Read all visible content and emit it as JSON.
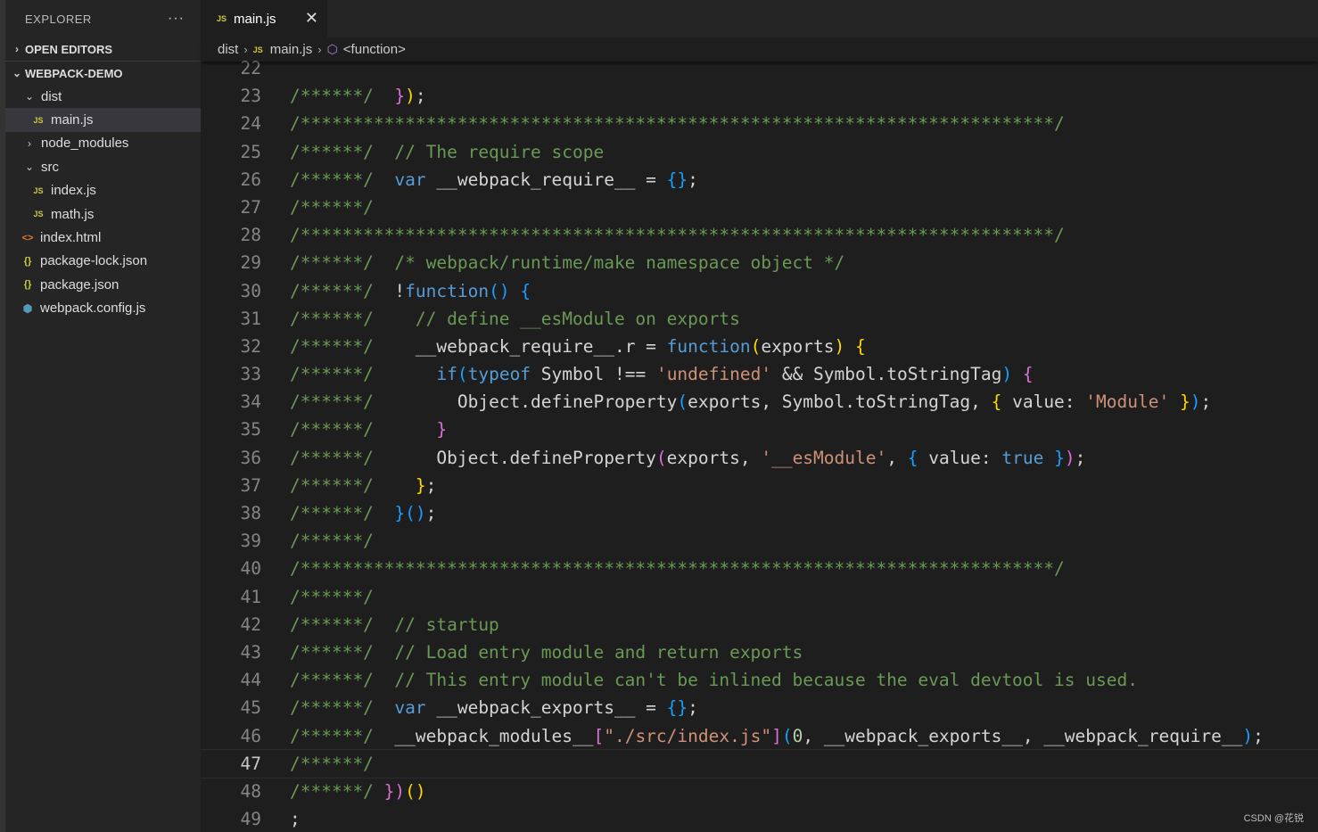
{
  "sidebar": {
    "title": "EXPLORER",
    "more_icon": "ellipsis-icon",
    "open_editors": "OPEN EDITORS",
    "project": "WEBPACK-DEMO",
    "tree": [
      {
        "label": "dist",
        "type": "folder",
        "expanded": true,
        "depth": 1
      },
      {
        "label": "main.js",
        "type": "js",
        "depth": 2,
        "selected": true
      },
      {
        "label": "node_modules",
        "type": "folder",
        "expanded": false,
        "depth": 1
      },
      {
        "label": "src",
        "type": "folder",
        "expanded": true,
        "depth": 1
      },
      {
        "label": "index.js",
        "type": "js",
        "depth": 2
      },
      {
        "label": "math.js",
        "type": "js",
        "depth": 2
      },
      {
        "label": "index.html",
        "type": "html",
        "depth": 1
      },
      {
        "label": "package-lock.json",
        "type": "json",
        "depth": 1
      },
      {
        "label": "package.json",
        "type": "json",
        "depth": 1
      },
      {
        "label": "webpack.config.js",
        "type": "cfg",
        "depth": 1
      }
    ]
  },
  "tab": {
    "label": "main.js",
    "icon": "JS",
    "close": "✕"
  },
  "breadcrumb": {
    "folder": "dist",
    "file": "main.js",
    "symbol": "<function>"
  },
  "icons": {
    "js": "JS",
    "html": "<>",
    "json": "{}",
    "cfg": "⬢",
    "folder_open": "⌄",
    "folder_closed": "›"
  },
  "editor": {
    "current_line": 47,
    "lines": [
      {
        "n": 22,
        "t": [
          [
            "pl",
            ""
          ]
        ]
      },
      {
        "n": 23,
        "t": [
          [
            "cm",
            "/******/  "
          ],
          [
            "br2",
            "}"
          ],
          [
            "br1",
            ")"
          ],
          [
            "pl",
            ";"
          ]
        ]
      },
      {
        "n": 24,
        "t": [
          [
            "cm",
            "/************************************************************************/"
          ]
        ]
      },
      {
        "n": 25,
        "t": [
          [
            "cm",
            "/******/  // The require scope"
          ]
        ]
      },
      {
        "n": 26,
        "t": [
          [
            "cm",
            "/******/  "
          ],
          [
            "kw",
            "var"
          ],
          [
            "pl",
            " __webpack_require__ = "
          ],
          [
            "br3",
            "{}"
          ],
          [
            "pl",
            ";"
          ]
        ]
      },
      {
        "n": 27,
        "t": [
          [
            "cm",
            "/******/"
          ]
        ]
      },
      {
        "n": 28,
        "t": [
          [
            "cm",
            "/************************************************************************/"
          ]
        ]
      },
      {
        "n": 29,
        "t": [
          [
            "cm",
            "/******/  /* webpack/runtime/make namespace object */"
          ]
        ]
      },
      {
        "n": 30,
        "t": [
          [
            "cm",
            "/******/  "
          ],
          [
            "pl",
            "!"
          ],
          [
            "kw",
            "function"
          ],
          [
            "br3",
            "()"
          ],
          [
            "pl",
            " "
          ],
          [
            "br3",
            "{"
          ]
        ]
      },
      {
        "n": 31,
        "t": [
          [
            "cm",
            "/******/    // define __esModule on exports"
          ]
        ]
      },
      {
        "n": 32,
        "t": [
          [
            "cm",
            "/******/    "
          ],
          [
            "pl",
            "__webpack_require__.r = "
          ],
          [
            "kw",
            "function"
          ],
          [
            "br1",
            "("
          ],
          [
            "pl",
            "exports"
          ],
          [
            "br1",
            ")"
          ],
          [
            "pl",
            " "
          ],
          [
            "br1",
            "{"
          ]
        ]
      },
      {
        "n": 33,
        "t": [
          [
            "cm",
            "/******/      "
          ],
          [
            "kw",
            "if"
          ],
          [
            "br3",
            "("
          ],
          [
            "kw",
            "typeof"
          ],
          [
            "pl",
            " Symbol !== "
          ],
          [
            "str",
            "'undefined'"
          ],
          [
            "pl",
            " && Symbol.toStringTag"
          ],
          [
            "br3",
            ")"
          ],
          [
            "pl",
            " "
          ],
          [
            "br2",
            "{"
          ]
        ]
      },
      {
        "n": 34,
        "t": [
          [
            "cm",
            "/******/        "
          ],
          [
            "pl",
            "Object.defineProperty"
          ],
          [
            "br3",
            "("
          ],
          [
            "pl",
            "exports, Symbol.toStringTag, "
          ],
          [
            "br1",
            "{"
          ],
          [
            "pl",
            " value: "
          ],
          [
            "str",
            "'Module'"
          ],
          [
            "pl",
            " "
          ],
          [
            "br1",
            "}"
          ],
          [
            "br3",
            ")"
          ],
          [
            "pl",
            ";"
          ]
        ]
      },
      {
        "n": 35,
        "t": [
          [
            "cm",
            "/******/      "
          ],
          [
            "br2",
            "}"
          ]
        ]
      },
      {
        "n": 36,
        "t": [
          [
            "cm",
            "/******/      "
          ],
          [
            "pl",
            "Object.defineProperty"
          ],
          [
            "br2",
            "("
          ],
          [
            "pl",
            "exports, "
          ],
          [
            "str",
            "'__esModule'"
          ],
          [
            "pl",
            ", "
          ],
          [
            "br3",
            "{"
          ],
          [
            "pl",
            " value: "
          ],
          [
            "kw",
            "true"
          ],
          [
            "pl",
            " "
          ],
          [
            "br3",
            "}"
          ],
          [
            "br2",
            ")"
          ],
          [
            "pl",
            ";"
          ]
        ]
      },
      {
        "n": 37,
        "t": [
          [
            "cm",
            "/******/    "
          ],
          [
            "br1",
            "}"
          ],
          [
            "pl",
            ";"
          ]
        ]
      },
      {
        "n": 38,
        "t": [
          [
            "cm",
            "/******/  "
          ],
          [
            "br3",
            "}"
          ],
          [
            "br3",
            "()"
          ],
          [
            "pl",
            ";"
          ]
        ]
      },
      {
        "n": 39,
        "t": [
          [
            "cm",
            "/******/"
          ]
        ]
      },
      {
        "n": 40,
        "t": [
          [
            "cm",
            "/************************************************************************/"
          ]
        ]
      },
      {
        "n": 41,
        "t": [
          [
            "cm",
            "/******/"
          ]
        ]
      },
      {
        "n": 42,
        "t": [
          [
            "cm",
            "/******/  // startup"
          ]
        ]
      },
      {
        "n": 43,
        "t": [
          [
            "cm",
            "/******/  // Load entry module and return exports"
          ]
        ]
      },
      {
        "n": 44,
        "t": [
          [
            "cm",
            "/******/  // This entry module can't be inlined because the eval devtool is used."
          ]
        ]
      },
      {
        "n": 45,
        "t": [
          [
            "cm",
            "/******/  "
          ],
          [
            "kw",
            "var"
          ],
          [
            "pl",
            " __webpack_exports__ = "
          ],
          [
            "br3",
            "{}"
          ],
          [
            "pl",
            ";"
          ]
        ]
      },
      {
        "n": 46,
        "t": [
          [
            "cm",
            "/******/  "
          ],
          [
            "pl",
            "__webpack_modules__"
          ],
          [
            "br2",
            "["
          ],
          [
            "str",
            "\"./src/index.js\""
          ],
          [
            "br2",
            "]"
          ],
          [
            "br3",
            "("
          ],
          [
            "num",
            "0"
          ],
          [
            "pl",
            ", __webpack_exports__, __webpack_require__"
          ],
          [
            "br3",
            ")"
          ],
          [
            "pl",
            ";"
          ]
        ]
      },
      {
        "n": 47,
        "t": [
          [
            "cm",
            "/******/"
          ]
        ]
      },
      {
        "n": 48,
        "t": [
          [
            "cm",
            "/******/ "
          ],
          [
            "br2",
            "}"
          ],
          [
            "br2",
            ")"
          ],
          [
            "br1",
            "()"
          ]
        ]
      },
      {
        "n": 49,
        "t": [
          [
            "pl",
            ";"
          ]
        ]
      }
    ]
  },
  "watermark": "CSDN @花锐"
}
